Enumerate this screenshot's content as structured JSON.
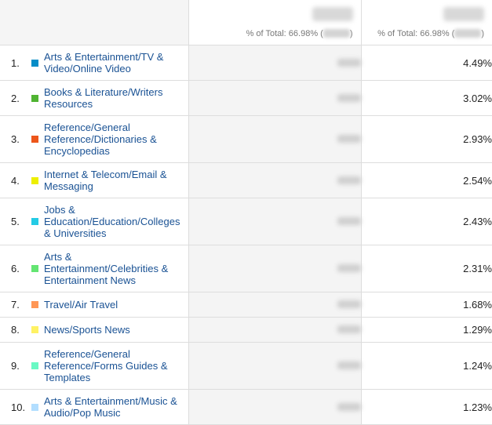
{
  "header": {
    "col2_subtitle": "% of Total: 66.98% (",
    "col3_subtitle": "% of Total: 66.98% ("
  },
  "rows": [
    {
      "index": "1.",
      "label": "Arts & Entertainment/TV & Video/Online Video",
      "percent": "4.49%",
      "color": "#058dc7",
      "lines": 2
    },
    {
      "index": "2.",
      "label": "Books & Literature/Writers Resources",
      "percent": "3.02%",
      "color": "#50b432",
      "lines": 2
    },
    {
      "index": "3.",
      "label": "Reference/General Reference/Dictionaries & Encyclopedias",
      "percent": "2.93%",
      "color": "#ed561b",
      "lines": 3
    },
    {
      "index": "4.",
      "label": "Internet & Telecom/Email & Messaging",
      "percent": "2.54%",
      "color": "#edef00",
      "lines": 2
    },
    {
      "index": "5.",
      "label": "Jobs & Education/Education/Colleges & Universities",
      "percent": "2.43%",
      "color": "#24cbe5",
      "lines": 3
    },
    {
      "index": "6.",
      "label": "Arts & Entertainment/Celebrities & Entertainment News",
      "percent": "2.31%",
      "color": "#64e572",
      "lines": 3
    },
    {
      "index": "7.",
      "label": "Travel/Air Travel",
      "percent": "1.68%",
      "color": "#ff9655",
      "lines": 1
    },
    {
      "index": "8.",
      "label": "News/Sports News",
      "percent": "1.29%",
      "color": "#fff263",
      "lines": 1
    },
    {
      "index": "9.",
      "label": "Reference/General Reference/Forms Guides & Templates",
      "percent": "1.24%",
      "color": "#6af9c4",
      "lines": 3
    },
    {
      "index": "10.",
      "label": "Arts & Entertainment/Music & Audio/Pop Music",
      "percent": "1.23%",
      "color": "#b2deff",
      "lines": 2
    }
  ]
}
